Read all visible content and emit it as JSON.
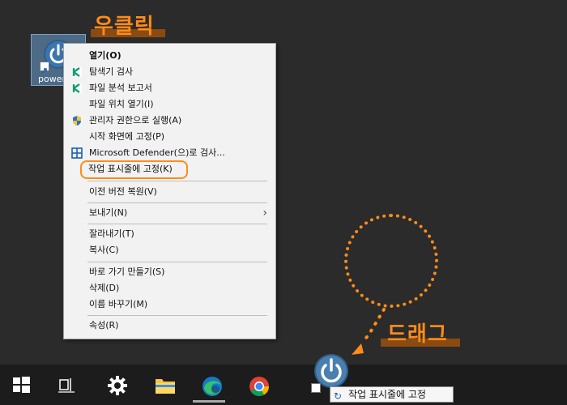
{
  "desktop_icon": {
    "label": "power"
  },
  "callouts": {
    "right_click": "우클릭",
    "drag": "드래그"
  },
  "accent_color": "#ff8c1a",
  "context_menu": {
    "items": [
      {
        "label": "열기(O)",
        "bold": true,
        "icon": ""
      },
      {
        "label": "탐색기 검사",
        "icon": "kaspersky-icon"
      },
      {
        "label": "파일 분석 보고서",
        "icon": "kaspersky-icon"
      },
      {
        "label": "파일 위치 열기(I)",
        "icon": ""
      },
      {
        "label": "관리자 권한으로 실행(A)",
        "icon": "uac-shield-icon"
      },
      {
        "label": "시작 화면에 고정(P)",
        "icon": ""
      },
      {
        "label": "Microsoft Defender(으)로 검사...",
        "icon": "defender-icon"
      },
      {
        "label": "작업 표시줄에 고정(K)",
        "icon": "",
        "highlighted": true
      },
      {
        "label": "이전 버전 복원(V)",
        "icon": ""
      },
      {
        "label": "보내기(N)",
        "icon": "",
        "submenu": true
      },
      {
        "label": "잘라내기(T)",
        "icon": ""
      },
      {
        "label": "복사(C)",
        "icon": ""
      },
      {
        "label": "바로 가기 만들기(S)",
        "icon": ""
      },
      {
        "label": "삭제(D)",
        "icon": ""
      },
      {
        "label": "이름 바꾸기(M)",
        "icon": ""
      },
      {
        "label": "속성(R)",
        "icon": ""
      }
    ],
    "submenu_arrow": "›"
  },
  "taskbar": {
    "buttons": [
      {
        "name": "start-button",
        "icon": "windows-logo-icon"
      },
      {
        "name": "task-view-button",
        "icon": "task-view-icon"
      },
      {
        "name": "settings-button",
        "icon": "gear-icon"
      },
      {
        "name": "file-explorer-button",
        "icon": "folder-icon"
      },
      {
        "name": "edge-button",
        "icon": "edge-icon"
      },
      {
        "name": "chrome-button",
        "icon": "chrome-icon"
      }
    ]
  },
  "drag_tooltip": {
    "label": "작업 표시줄에 고정",
    "icon": "↻"
  }
}
